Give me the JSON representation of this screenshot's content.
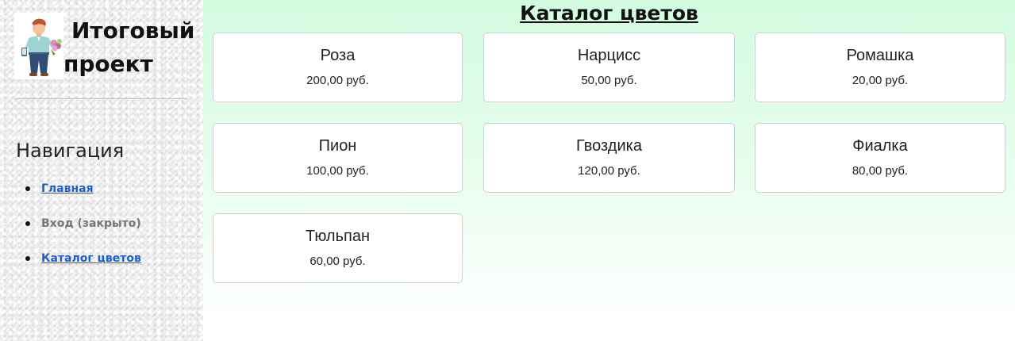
{
  "sidebar": {
    "brand_line1": "Итоговый",
    "brand_line2": "проект",
    "nav_heading": "Навигация",
    "nav_items": [
      {
        "label": "Главная",
        "active": true
      },
      {
        "label": "Вход (закрыто)",
        "active": false
      },
      {
        "label": "Каталог цветов",
        "active": true
      }
    ]
  },
  "main": {
    "title": "Каталог цветов",
    "products": [
      {
        "name": "Роза",
        "price": "200,00 руб."
      },
      {
        "name": "Нарцисс",
        "price": "50,00 руб."
      },
      {
        "name": "Ромашка",
        "price": "20,00 руб."
      },
      {
        "name": "Пион",
        "price": "100,00 руб."
      },
      {
        "name": "Гвоздика",
        "price": "120,00 руб."
      },
      {
        "name": "Фиалка",
        "price": "80,00 руб."
      },
      {
        "name": "Тюльпан",
        "price": "60,00 руб."
      }
    ]
  },
  "colors": {
    "link": "#1a5fd1",
    "disabled": "#777777",
    "main_bg_top": "#d3fbe0",
    "card_border": "#cfcfcf"
  },
  "icons": {
    "avatar": "florist-illustration"
  }
}
